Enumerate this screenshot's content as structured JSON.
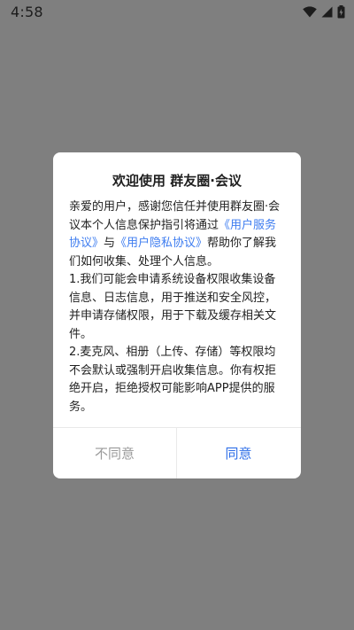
{
  "status_bar": {
    "time": "4:58",
    "icons": [
      "wifi-icon",
      "cell-signal-icon",
      "battery-icon"
    ]
  },
  "dialog": {
    "title": "欢迎使用 群友圈·会议",
    "intro_prefix": "亲爱的用户，感谢您信任并使用群友圈·会议本个人信息保护指引将通过",
    "user_agreement_link": "《用户服务协议》",
    "conjunction": "与",
    "privacy_policy_link": "《用户隐私协议》",
    "intro_suffix": "帮助你了解我们如何收集、处理个人信息。",
    "point1": "1.我们可能会申请系统设备权限收集设备 信息、日志信息，用于推送和安全风控， 并申请存储权限，用于下载及缓存相关文件。",
    "point2": "2.麦克风、相册（上传、存储）等权限均 不会默认或强制开启收集信息。你有权拒绝开启，拒绝授权可能影响APP提供的服务。",
    "disagree_label": "不同意",
    "agree_label": "同意"
  },
  "colors": {
    "overlay": "#7f7f7f",
    "link": "#3d7cf0",
    "agree": "#2f6fe8",
    "disagree": "#9a9a9a"
  }
}
